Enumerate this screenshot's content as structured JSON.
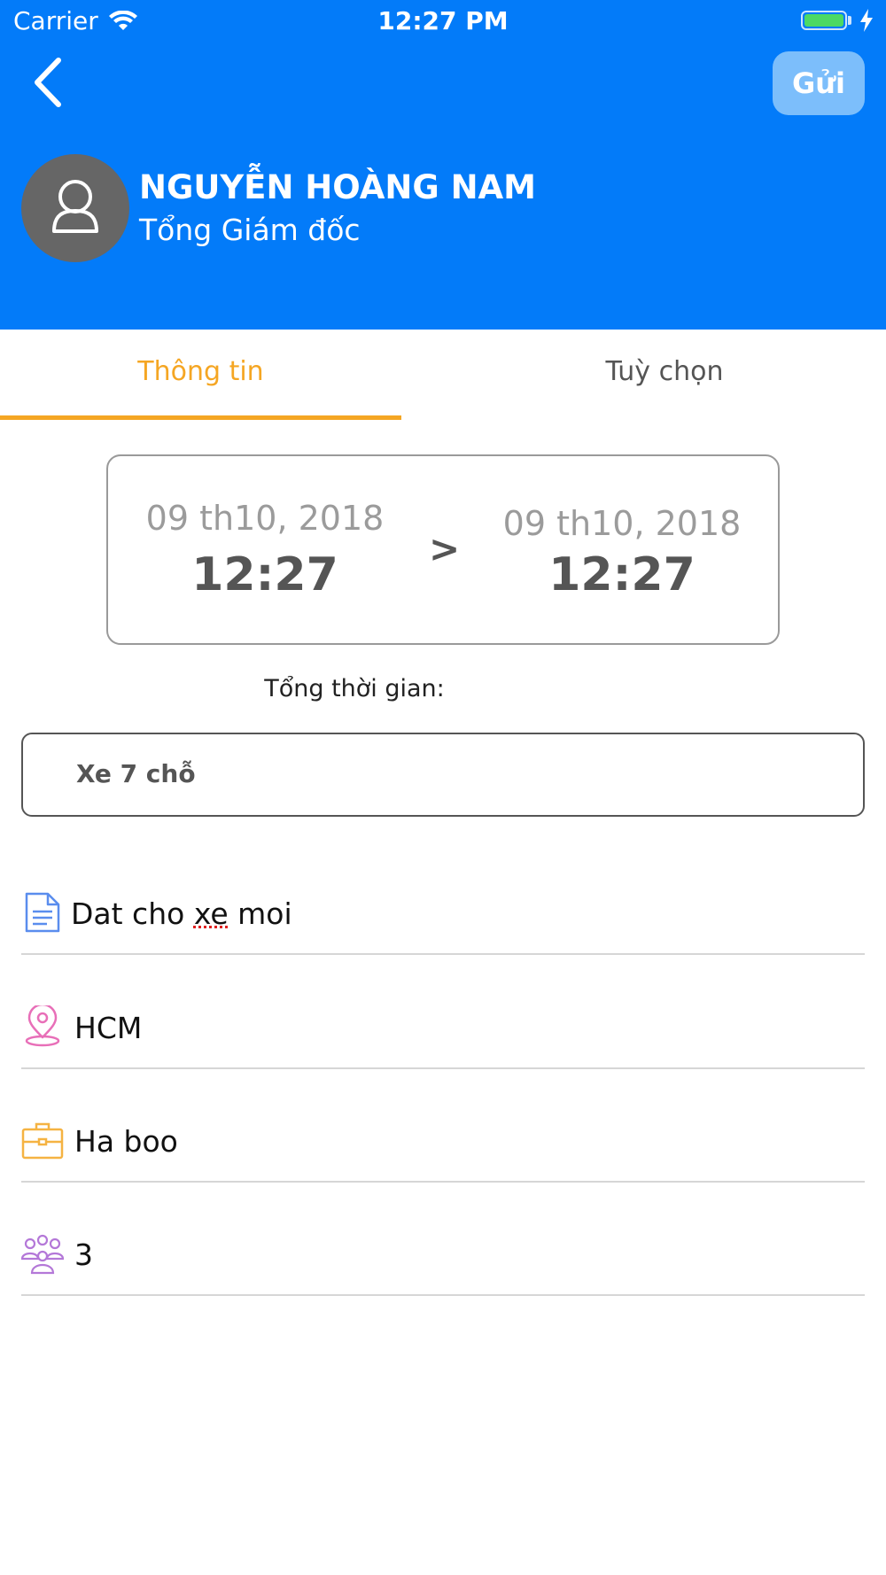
{
  "status_bar": {
    "carrier": "Carrier",
    "time": "12:27 PM",
    "battery_percent": 100
  },
  "header": {
    "send_label": "Gửi",
    "user_name": "NGUYỄN HOÀNG NAM",
    "user_title": "Tổng Giám đốc"
  },
  "tabs": [
    {
      "label": "Thông tin",
      "active": true
    },
    {
      "label": "Tuỳ chọn",
      "active": false
    }
  ],
  "schedule": {
    "start": {
      "date": "09 th10, 2018",
      "time": "12:27"
    },
    "end": {
      "date": "09 th10, 2018",
      "time": "12:27"
    },
    "arrow": ">",
    "total_time_label": "Tổng thời gian:"
  },
  "vehicle": "Xe 7 chỗ",
  "details": {
    "note_before": "Dat cho ",
    "note_misspelled": "xe",
    "note_after": " moi",
    "location": "HCM",
    "purpose": "Ha boo",
    "people": "3"
  },
  "colors": {
    "header_bg": "#037BF9",
    "active_tab": "#F5A623",
    "send_button": "#7CBEFB"
  }
}
